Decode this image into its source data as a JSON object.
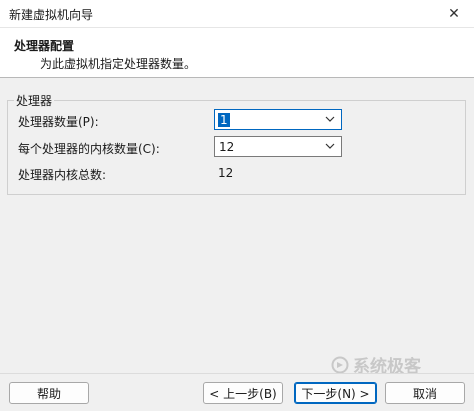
{
  "window": {
    "title": "新建虚拟机向导",
    "close_glyph": "✕"
  },
  "header": {
    "title": "处理器配置",
    "subtitle": "为此虚拟机指定处理器数量。"
  },
  "processors_group": {
    "legend": "处理器",
    "processor_count": {
      "label": "处理器数量(P):",
      "value": "1"
    },
    "cores_per_processor": {
      "label": "每个处理器的内核数量(C):",
      "value": "12"
    },
    "total_cores": {
      "label": "处理器内核总数:",
      "value": "12"
    }
  },
  "watermark": {
    "text": "系统极客"
  },
  "footer": {
    "help_label": "帮助",
    "back_label": "< 上一步(B)",
    "next_label": "下一步(N) >",
    "cancel_label": "取消"
  },
  "icons": {
    "dropdown": "chevron-down-icon",
    "close": "close-icon",
    "watermark": "logo-icon"
  },
  "colors": {
    "accent": "#0067c0",
    "window_bg": "#f0f0f0",
    "header_bg": "#ffffff"
  }
}
